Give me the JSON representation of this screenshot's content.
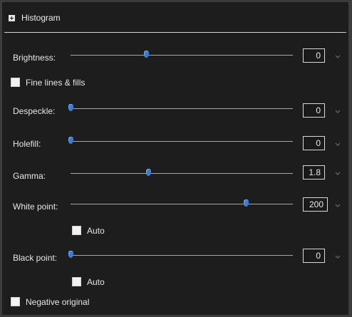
{
  "header": {
    "title": "Histogram"
  },
  "brightness": {
    "label": "Brightness:",
    "value": "0",
    "level": 0.34
  },
  "fine_lines": {
    "label": "Fine lines & fills",
    "checked": false
  },
  "despeckle": {
    "label": "Despeckle:",
    "value": "0",
    "level": 0.0
  },
  "holefill": {
    "label": "Holefill:",
    "value": "0",
    "level": 0.0
  },
  "gamma": {
    "label": "Gamma:",
    "value": "1.8",
    "level": 0.35
  },
  "white_point": {
    "label": "White point:",
    "value": "200",
    "level": 0.79,
    "auto_label": "Auto"
  },
  "black_point": {
    "label": "Black point:",
    "value": "0",
    "level": 0.0,
    "auto_label": "Auto"
  },
  "negative": {
    "label": "Negative original",
    "checked": false
  },
  "colors": {
    "thumb": "#3b7bd6",
    "panel": "#1d1d1d",
    "track": "#a7a7a7"
  }
}
